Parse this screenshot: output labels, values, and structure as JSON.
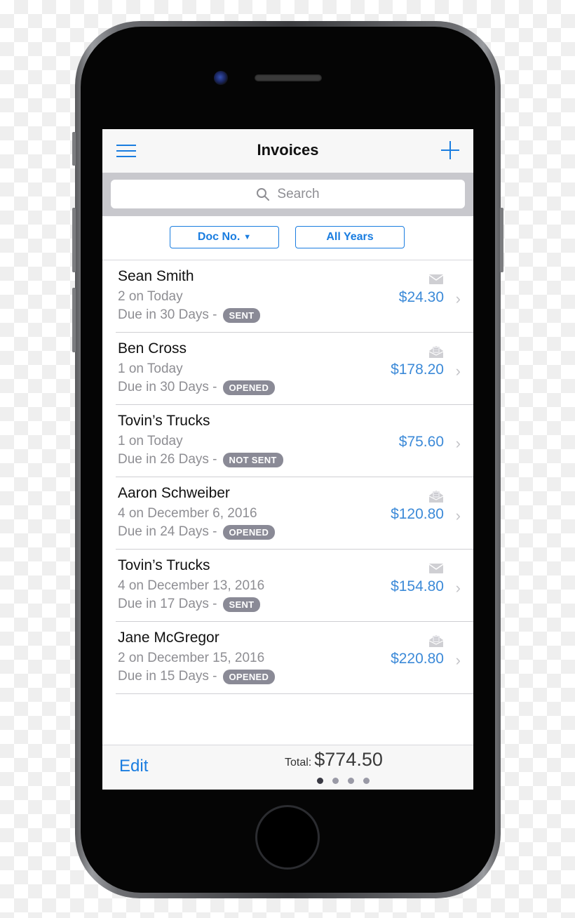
{
  "navbar": {
    "title": "Invoices",
    "menu_icon": "hamburger-menu-icon",
    "add_icon": "plus-icon"
  },
  "search": {
    "placeholder": "Search",
    "icon": "magnifier-icon"
  },
  "filters": {
    "sort_label": "Doc No.",
    "sort_caret": "▼",
    "year_label": "All Years"
  },
  "invoices": [
    {
      "name": "Sean Smith",
      "doc": "2 on Today",
      "due": "Due in 30 Days -",
      "status": "SENT",
      "amount": "$24.30",
      "mail_icon": "envelope-closed-icon"
    },
    {
      "name": "Ben Cross",
      "doc": "1 on Today",
      "due": "Due in 30 Days -",
      "status": "OPENED",
      "amount": "$178.20",
      "mail_icon": "envelope-open-icon"
    },
    {
      "name": "Tovin’s Trucks",
      "doc": "1 on Today",
      "due": "Due in 26 Days -",
      "status": "NOT SENT",
      "amount": "$75.60",
      "mail_icon": null
    },
    {
      "name": "Aaron Schweiber",
      "doc": "4 on December 6, 2016",
      "due": "Due in 24 Days -",
      "status": "OPENED",
      "amount": "$120.80",
      "mail_icon": "envelope-open-icon"
    },
    {
      "name": "Tovin’s Trucks",
      "doc": "4 on December 13, 2016",
      "due": "Due in 17 Days -",
      "status": "SENT",
      "amount": "$154.80",
      "mail_icon": "envelope-closed-icon"
    },
    {
      "name": "Jane McGregor",
      "doc": "2 on December 15, 2016",
      "due": "Due in 15 Days -",
      "status": "OPENED",
      "amount": "$220.80",
      "mail_icon": "envelope-open-icon"
    }
  ],
  "chevron": "›",
  "toolbar": {
    "edit_label": "Edit",
    "total_label": "Total:",
    "total_value": "$774.50",
    "page_count": 4,
    "active_page": 1
  },
  "colors": {
    "accent": "#1a7de0",
    "amount": "#3c8ad8",
    "badge": "#8a8a96"
  }
}
